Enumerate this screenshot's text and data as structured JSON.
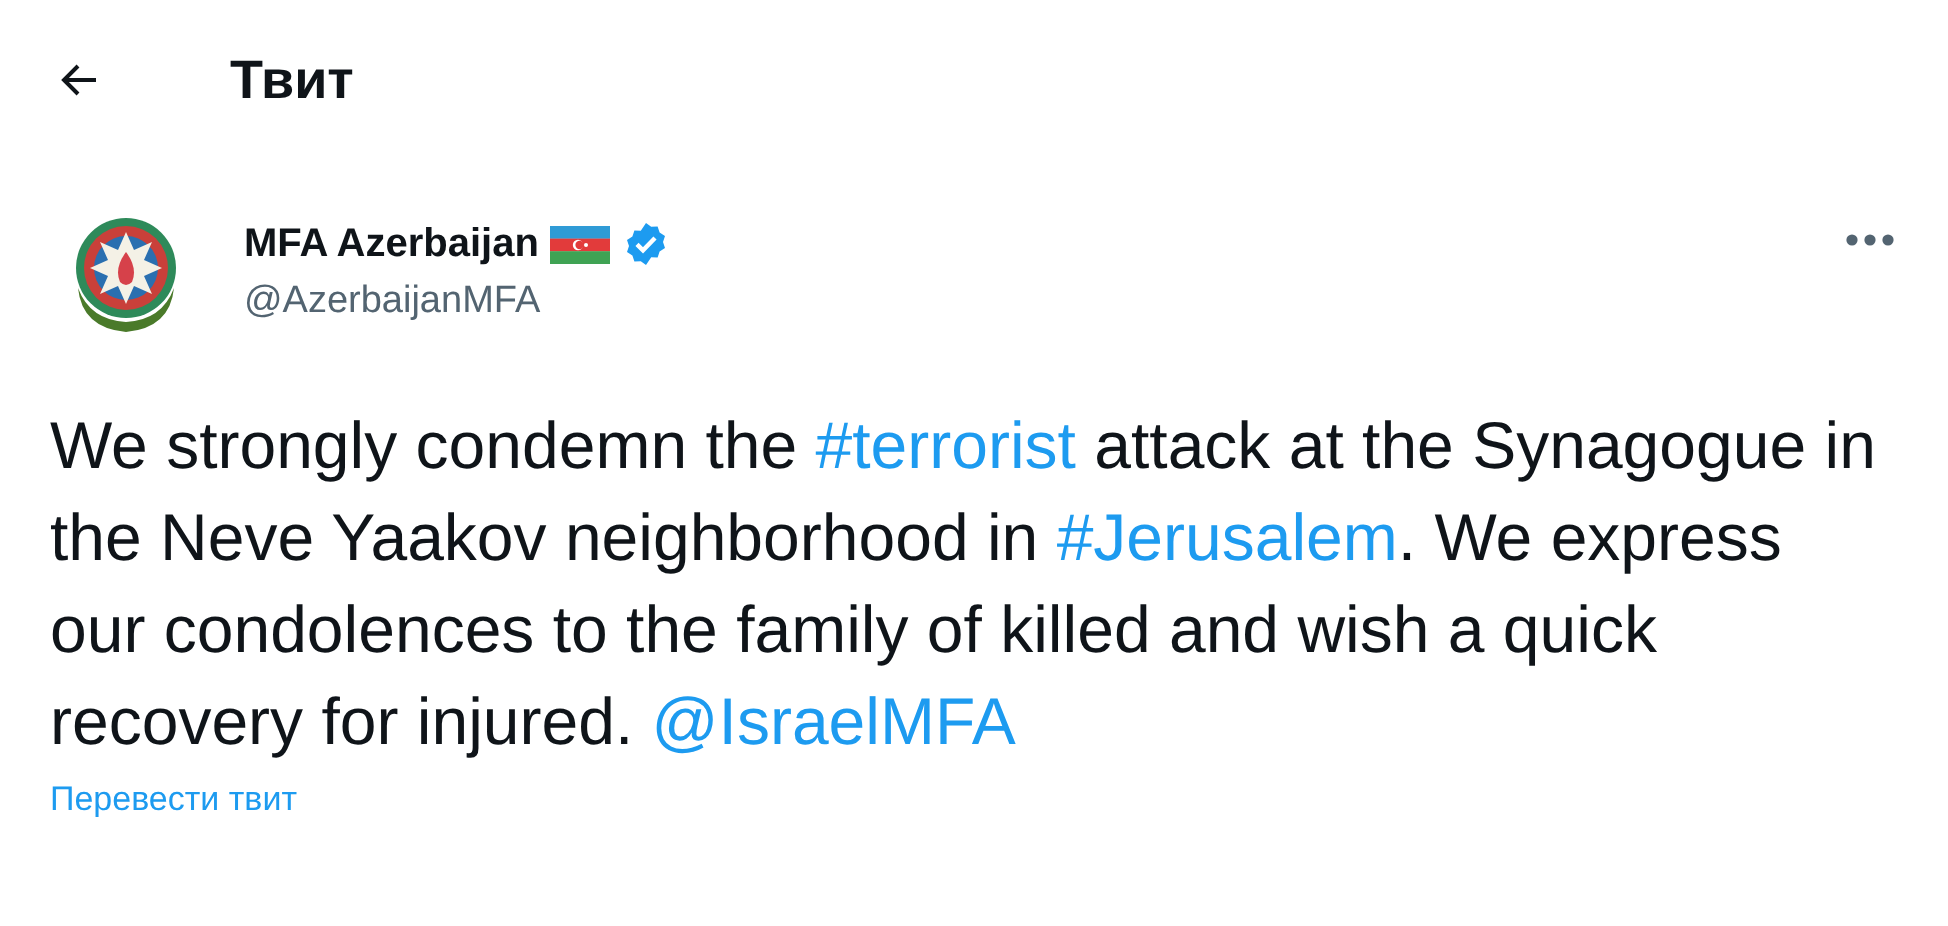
{
  "header": {
    "title": "Твит"
  },
  "author": {
    "name": "MFA Azerbaijan",
    "handle": "@AzerbaijanMFA",
    "verified": true
  },
  "tweet": {
    "segments": [
      {
        "kind": "text",
        "text": "We strongly condemn the "
      },
      {
        "kind": "hashtag",
        "text": "#terrorist"
      },
      {
        "kind": "text",
        "text": " attack at the Synagogue in the Neve Yaakov neighborhood in "
      },
      {
        "kind": "hashtag",
        "text": "#Jerusalem"
      },
      {
        "kind": "text",
        "text": ". We express our condolences to the family of killed and wish a quick recovery for injured. "
      },
      {
        "kind": "mention",
        "text": "@IsraelMFA"
      }
    ],
    "translate_link": "Перевести твит"
  }
}
